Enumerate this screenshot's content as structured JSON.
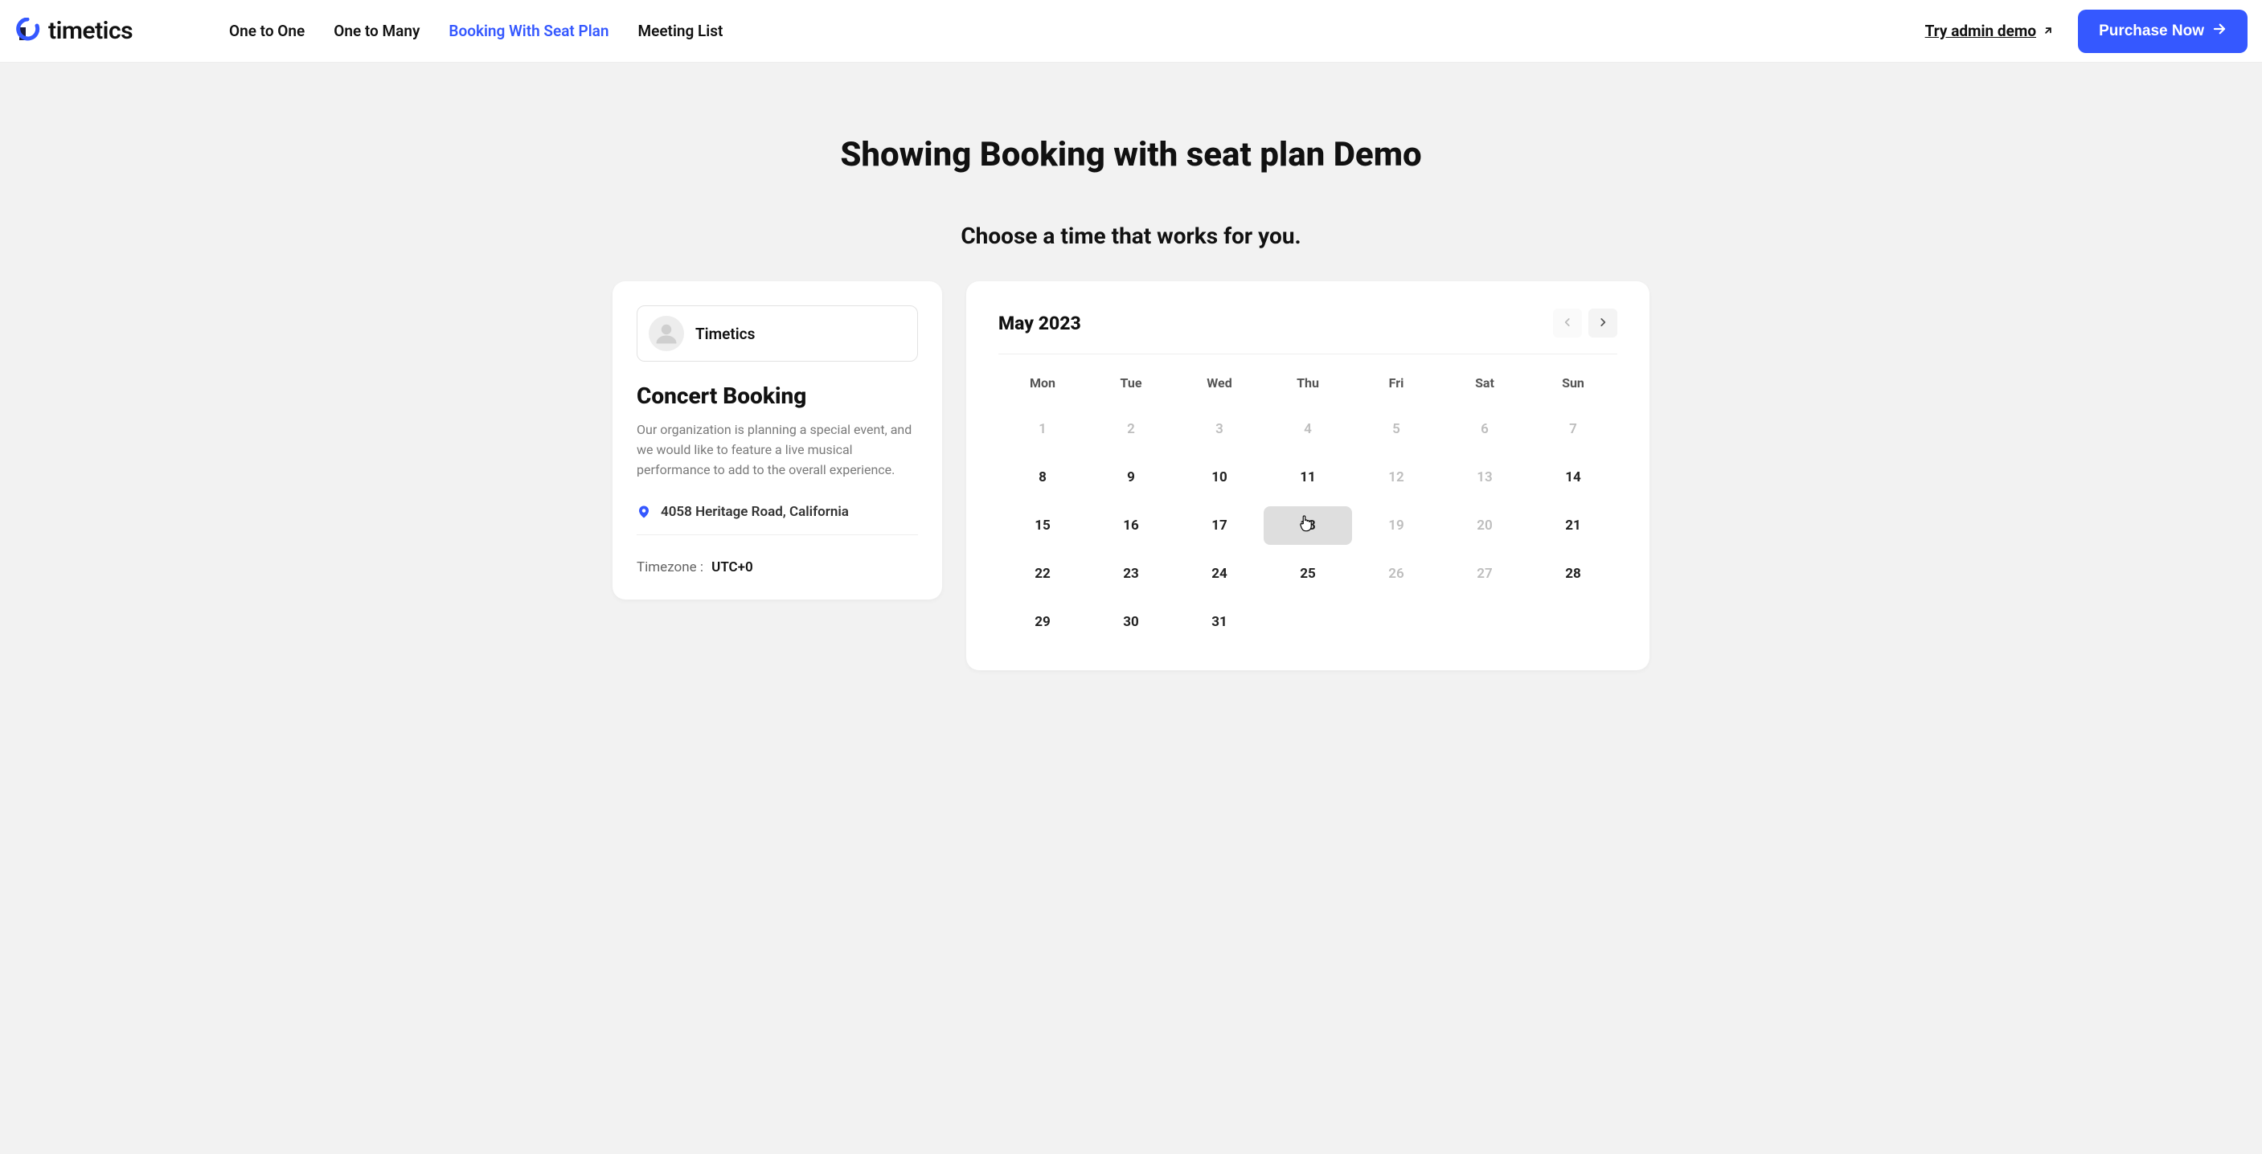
{
  "header": {
    "logo_text": "timetics",
    "nav": [
      {
        "label": "One to One",
        "active": false
      },
      {
        "label": "One to Many",
        "active": false
      },
      {
        "label": "Booking With Seat Plan",
        "active": true
      },
      {
        "label": "Meeting List",
        "active": false
      }
    ],
    "try_demo_label": "Try admin demo",
    "purchase_label": "Purchase Now"
  },
  "page": {
    "title": "Showing Booking with seat plan Demo",
    "subtitle": "Choose a time that works for you."
  },
  "event": {
    "host": "Timetics",
    "title": "Concert Booking",
    "description": "Our organization is planning a special event, and we would like to feature a live musical performance to add to the overall experience.",
    "location": "4058 Heritage Road, California",
    "tz_label": "Timezone :",
    "tz_value": "UTC+0"
  },
  "calendar": {
    "month_label": "May 2023",
    "dow": [
      "Mon",
      "Tue",
      "Wed",
      "Thu",
      "Fri",
      "Sat",
      "Sun"
    ],
    "days": [
      {
        "n": "1",
        "muted": true
      },
      {
        "n": "2",
        "muted": true
      },
      {
        "n": "3",
        "muted": true
      },
      {
        "n": "4",
        "muted": true
      },
      {
        "n": "5",
        "muted": true
      },
      {
        "n": "6",
        "muted": true
      },
      {
        "n": "7",
        "muted": true
      },
      {
        "n": "8"
      },
      {
        "n": "9"
      },
      {
        "n": "10"
      },
      {
        "n": "11"
      },
      {
        "n": "12",
        "muted": true
      },
      {
        "n": "13",
        "muted": true
      },
      {
        "n": "14"
      },
      {
        "n": "15"
      },
      {
        "n": "16"
      },
      {
        "n": "17"
      },
      {
        "n": "18",
        "hovered": true
      },
      {
        "n": "19",
        "muted": true
      },
      {
        "n": "20",
        "muted": true
      },
      {
        "n": "21"
      },
      {
        "n": "22"
      },
      {
        "n": "23"
      },
      {
        "n": "24"
      },
      {
        "n": "25"
      },
      {
        "n": "26",
        "muted": true
      },
      {
        "n": "27",
        "muted": true
      },
      {
        "n": "28"
      },
      {
        "n": "29"
      },
      {
        "n": "30"
      },
      {
        "n": "31"
      }
    ]
  }
}
